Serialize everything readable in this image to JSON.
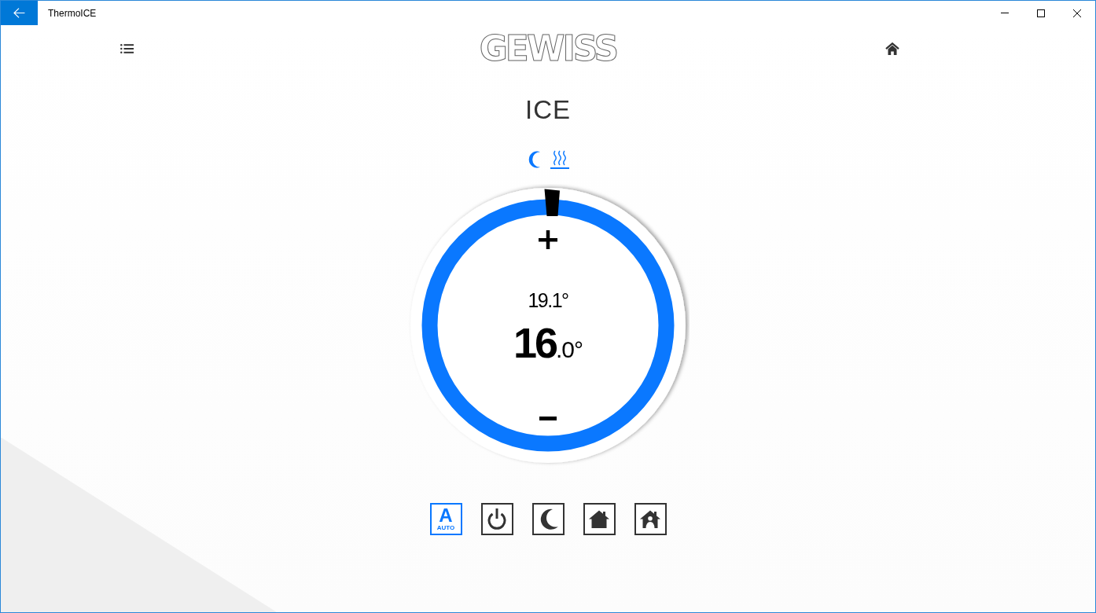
{
  "window": {
    "title": "ThermoICE"
  },
  "header": {
    "logo": "GEWISS"
  },
  "zone": {
    "name": "ICE",
    "status_icons": [
      {
        "kind": "moon"
      },
      {
        "kind": "heating"
      }
    ]
  },
  "dial": {
    "measured": "19.1°",
    "setpoint_integer": "16",
    "setpoint_decimal": ".0°"
  },
  "modes": [
    {
      "kind": "auto",
      "letter": "A",
      "label": "AUTO",
      "selected": true
    },
    {
      "kind": "off",
      "selected": false
    },
    {
      "kind": "night",
      "selected": false
    },
    {
      "kind": "comfort",
      "selected": false
    },
    {
      "kind": "presence",
      "selected": false
    }
  ]
}
